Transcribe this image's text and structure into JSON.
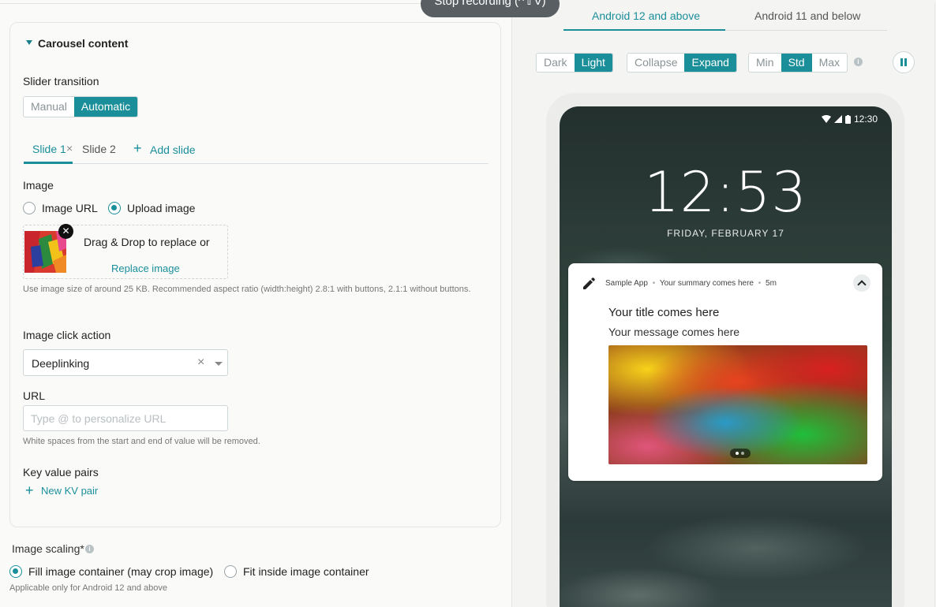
{
  "recording": {
    "label": "Stop recording (^⇧V)"
  },
  "carousel": {
    "section_title": "Carousel content",
    "slider_transition_label": "Slider transition",
    "slider_transition_options": [
      "Manual",
      "Automatic"
    ],
    "slider_transition_selected": "Automatic",
    "tabs": [
      "Slide 1",
      "Slide 2"
    ],
    "tab_close": "×",
    "active_tab": "Slide 1",
    "add_slide_label": "Add slide",
    "image_label": "Image",
    "image_source_options": [
      "Image URL",
      "Upload image"
    ],
    "image_source_selected": "Upload image",
    "dropzone_text": "Drag & Drop to replace or",
    "replace_link": "Replace image",
    "image_help": "Use image size of around 25 KB. Recommended aspect ratio (width:height) 2.8:1 with buttons, 2.1:1 without buttons.",
    "click_action_label": "Image click action",
    "click_action_value": "Deeplinking",
    "url_label": "URL",
    "url_placeholder": "Type @ to personalize URL",
    "url_help": "White spaces from the start and end of value will be removed.",
    "kv_label": "Key value pairs",
    "kv_add_label": "New KV pair"
  },
  "image_scaling": {
    "label": "Image scaling*",
    "options": [
      "Fill image container (may crop image)",
      "Fit inside image container"
    ],
    "selected": "Fill image container (may crop image)",
    "help": "Applicable only for Android 12 and above"
  },
  "preview": {
    "os_tabs": [
      "Android 12 and above",
      "Android 11 and below"
    ],
    "os_tab_selected": "Android 12 and above",
    "theme_options": [
      "Dark",
      "Light"
    ],
    "theme_selected": "Light",
    "view_options": [
      "Collapse",
      "Expand"
    ],
    "view_selected": "Expand",
    "size_options": [
      "Min",
      "Std",
      "Max"
    ],
    "size_selected": "Std",
    "phone": {
      "status_time": "12:30",
      "clock": "12:53",
      "date": "FRIDAY, FEBRUARY 17"
    },
    "notification": {
      "app_name": "Sample App",
      "summary": "Your summary comes here",
      "age": "5m",
      "separator": "•",
      "title": "Your title comes here",
      "message": "Your message comes here"
    }
  },
  "colors": {
    "accent": "#1a8f9a"
  }
}
